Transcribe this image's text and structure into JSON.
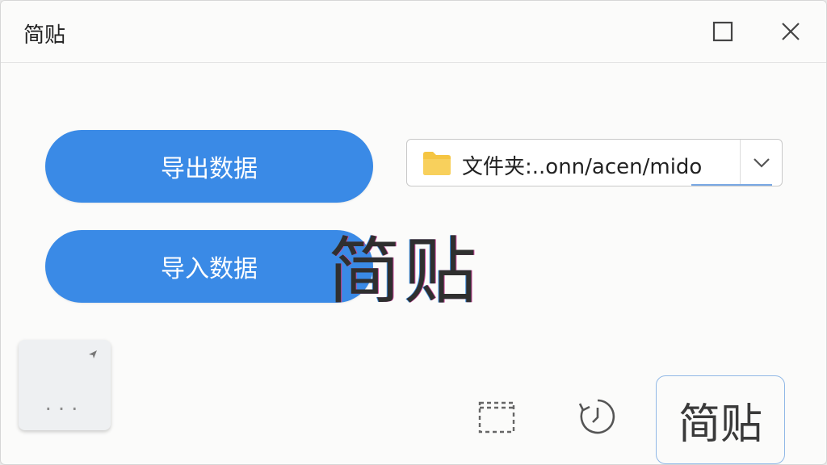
{
  "window": {
    "title": "简贴",
    "controls": [
      {
        "icon": "maximize-icon"
      },
      {
        "icon": "close-icon"
      }
    ]
  },
  "actions": {
    "export_label": "导出数据",
    "import_label": "导入数据"
  },
  "path_selector": {
    "icon": "folder-icon",
    "value": "文件夹:..onn/acen/mido"
  },
  "watermark": {
    "text": "简贴"
  },
  "more_card": {
    "dots": "...",
    "icon": "pin-icon"
  },
  "toolbar": {
    "select_area_icon": "dashed-select-icon",
    "history_icon": "history-icon",
    "brand_label": "简贴"
  },
  "colors": {
    "primary": "#3a8ae6",
    "accent_border": "#90b8e6",
    "window_bg": "#fbfbfa",
    "folder": "#f5c542"
  }
}
